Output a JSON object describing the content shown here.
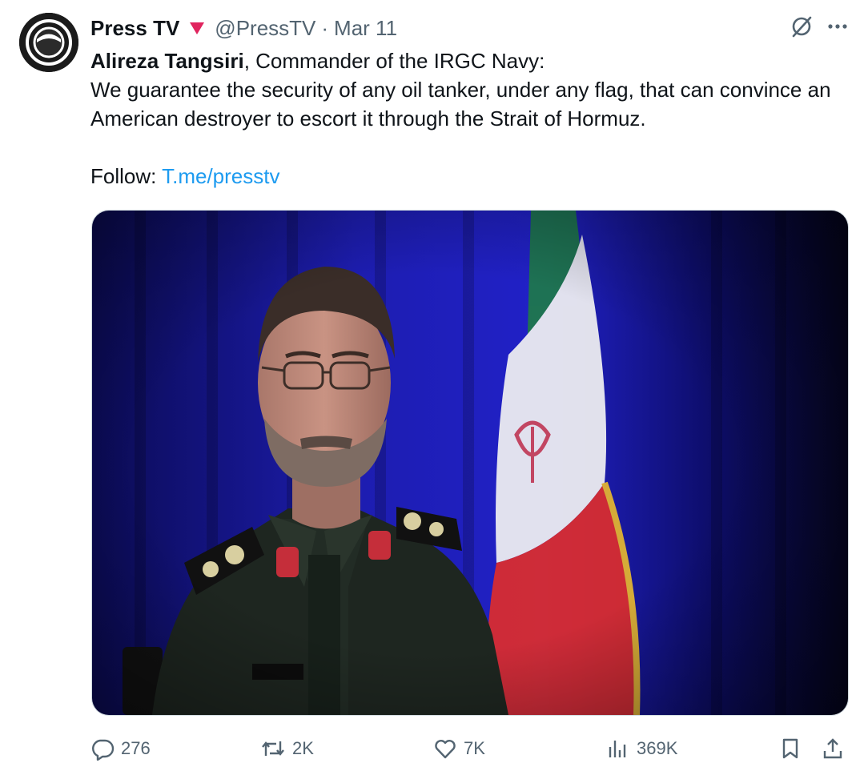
{
  "tweet": {
    "author_name": "Press TV",
    "author_handle": "@PressTV",
    "separator": "·",
    "date": "Mar 11",
    "badge_color": "#e0245e",
    "body": {
      "speaker": "Alireza Tangsiri",
      "speaker_rest": ", Commander of the IRGC Navy:",
      "quote": "We guarantee the security of any oil tanker, under any flag, that can convince an American destroyer to escort it through the Strait of Hormuz.",
      "follow_label": "Follow: ",
      "follow_link": "T.me/presstv"
    },
    "icons": {
      "grok": "grok-icon",
      "more": "more-icon"
    },
    "media": {
      "subject": "photo of IRGC Navy commander in uniform in front of Iranian flag",
      "background_color": "#1a1a9e"
    },
    "actions": {
      "replies": "276",
      "reposts": "2K",
      "likes": "7K",
      "views": "369K"
    }
  }
}
